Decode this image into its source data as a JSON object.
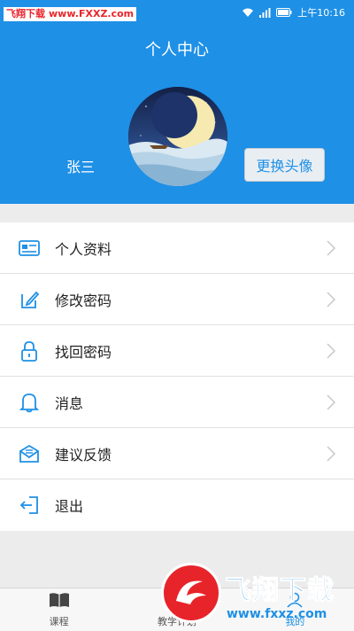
{
  "status_bar": {
    "watermark_cn": "飞翔下载",
    "watermark_url": "www.FXXZ.com",
    "time": "上午10:16"
  },
  "header": {
    "title": "个人中心",
    "username": "张三",
    "change_avatar_label": "更换头像"
  },
  "menu": {
    "items": [
      {
        "label": "个人资料",
        "icon": "id-card-icon",
        "chevron": true
      },
      {
        "label": "修改密码",
        "icon": "edit-icon",
        "chevron": true
      },
      {
        "label": "找回密码",
        "icon": "lock-icon",
        "chevron": true
      },
      {
        "label": "消息",
        "icon": "bell-icon",
        "chevron": true
      },
      {
        "label": "建议反馈",
        "icon": "mail-icon",
        "chevron": true
      },
      {
        "label": "退出",
        "icon": "logout-icon",
        "chevron": false
      }
    ]
  },
  "tabbar": {
    "tabs": [
      {
        "label": "课程",
        "icon": "book-icon",
        "active": false
      },
      {
        "label": "教学计划",
        "icon": "plan-icon",
        "active": false
      },
      {
        "label": "我的",
        "icon": "user-icon",
        "active": true
      }
    ]
  },
  "watermark": {
    "name": "飞翔下载",
    "url": "www.fxxz.com"
  },
  "colors": {
    "primary": "#1e90e6",
    "background": "#ececec",
    "watermark_red": "#e8242b"
  }
}
